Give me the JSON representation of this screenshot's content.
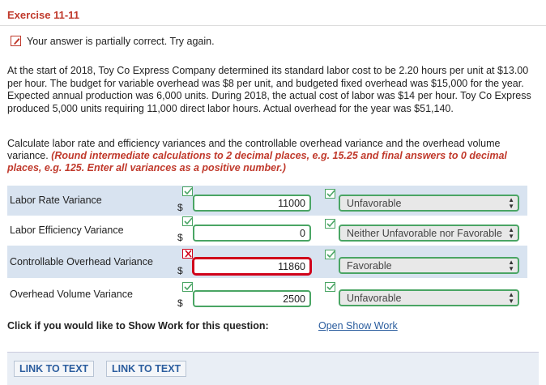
{
  "exercise": {
    "title": "Exercise 11-11"
  },
  "status": {
    "text": "Your answer is partially correct.  Try again."
  },
  "problem": {
    "text": "At the start of 2018, Toy Co Express Company determined its standard labor cost to be 2.20 hours per unit at $13.00 per hour. The budget for variable overhead was $8 per unit, and budgeted fixed overhead was $15,000 for the year. Expected annual production was 6,000 units. During 2018, the actual cost of labor was $14 per hour. Toy Co Express produced 5,000 units requiring 11,000 direct labor hours. Actual overhead for the year was $51,140."
  },
  "instructions": {
    "text": "Calculate labor rate and efficiency variances and the controllable overhead variance and the overhead volume variance.",
    "note": "(Round intermediate calculations to 2 decimal places, e.g. 15.25 and final answers to 0 decimal places, e.g. 125. Enter all variances as a positive number.)"
  },
  "variances": [
    {
      "label": "Labor Rate Variance",
      "currency": "$",
      "amount": "11000",
      "amount_correct": true,
      "type": "Unfavorable",
      "type_correct": true
    },
    {
      "label": "Labor Efficiency Variance",
      "currency": "$",
      "amount": "0",
      "amount_correct": true,
      "type": "Neither Unfavorable nor Favorable",
      "type_correct": true
    },
    {
      "label": "Controllable Overhead Variance",
      "currency": "$",
      "amount": "11860",
      "amount_correct": false,
      "type": "Favorable",
      "type_correct": true
    },
    {
      "label": "Overhead Volume Variance",
      "currency": "$",
      "amount": "2500",
      "amount_correct": true,
      "type": "Unfavorable",
      "type_correct": true
    }
  ],
  "show_work": {
    "label": "Click if you would like to Show Work for this question:",
    "link": "Open Show Work"
  },
  "footer": {
    "link1": "LINK TO TEXT",
    "link2": "LINK TO TEXT"
  },
  "colors": {
    "correct": "#4aa564",
    "incorrect": "#d0021b",
    "title": "#c0392b",
    "link": "#2b5d9e",
    "row_alt": "#d8e3f0"
  },
  "icons": {
    "correct": "checkmark-icon",
    "incorrect": "x-mark-icon",
    "status": "pencil-check-icon"
  }
}
